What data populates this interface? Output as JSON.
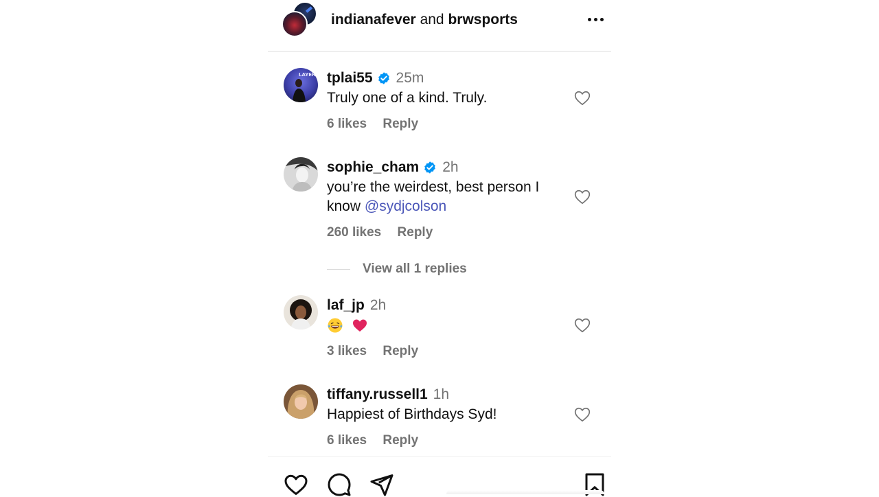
{
  "header": {
    "user1": "indianafever",
    "and_text": "and",
    "user2": "brwsports"
  },
  "comments": [
    {
      "username": "tplai55",
      "verified": true,
      "time": "25m",
      "text": "Truly one of a kind. Truly.",
      "likes": "6 likes",
      "reply": "Reply"
    },
    {
      "username": "sophie_cham",
      "verified": true,
      "time": "2h",
      "text": "you’re the weirdest, best person I know",
      "mention": "@sydjcolson",
      "likes": "260 likes",
      "reply": "Reply"
    },
    {
      "username": "laf_jp",
      "verified": false,
      "time": "2h",
      "emojis": [
        "laughing-with-tears-emoji",
        "red-heart-emoji"
      ],
      "likes": "3 likes",
      "reply": "Reply"
    },
    {
      "username": "tiffany.russell1",
      "verified": false,
      "time": "1h",
      "text": "Happiest of Birthdays Syd!",
      "likes": "6 likes",
      "reply": "Reply"
    }
  ],
  "view_replies": "View all 1 replies",
  "colors": {
    "verified_blue": "#0095f6",
    "mention": "#4a56b8",
    "muted": "#737373",
    "divider": "#dbdbdb",
    "heart_red": "#e0245e"
  },
  "icons": {
    "like": "heart-outline-icon",
    "comment": "comment-bubble-icon",
    "share": "paper-plane-icon",
    "save": "bookmark-icon",
    "more": "more-dots-icon",
    "verified": "verified-badge-icon"
  }
}
